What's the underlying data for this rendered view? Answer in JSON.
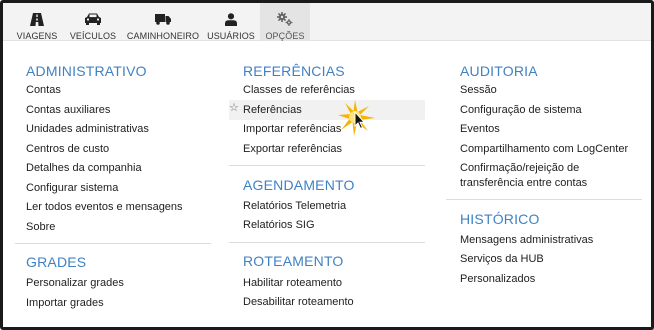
{
  "tabs": [
    {
      "label": "VIAGENS",
      "icon": "road-icon"
    },
    {
      "label": "VEÍCULOS",
      "icon": "car-icon"
    },
    {
      "label": "CAMINHONEIRO",
      "icon": "truck-icon"
    },
    {
      "label": "USUÁRIOS",
      "icon": "user-icon"
    },
    {
      "label": "OPÇÕES",
      "icon": "gears-icon",
      "active": true
    }
  ],
  "administrativo": {
    "title": "ADMINISTRATIVO",
    "items": [
      "Contas",
      "Contas auxiliares",
      "Unidades administrativas",
      "Centros de custo",
      "Detalhes da companhia",
      "Configurar sistema",
      "Ler todos eventos e mensagens",
      "Sobre"
    ]
  },
  "grades": {
    "title": "GRADES",
    "items": [
      "Personalizar grades",
      "Importar grades"
    ]
  },
  "referencias": {
    "title": "REFERÊNCIAS",
    "items": [
      "Classes de referências",
      "Referências",
      "Importar referências",
      "Exportar referências"
    ]
  },
  "agendamento": {
    "title": "AGENDAMENTO",
    "items": [
      "Relatórios Telemetria",
      "Relatórios SIG"
    ]
  },
  "roteamento": {
    "title": "ROTEAMENTO",
    "items": [
      "Habilitar roteamento",
      "Desabilitar roteamento"
    ]
  },
  "auditoria": {
    "title": "AUDITORIA",
    "items": [
      "Sessão",
      "Configuração de sistema",
      "Eventos",
      "Compartilhamento com LogCenter",
      "Confirmação/rejeição de",
      "transferência entre contas"
    ]
  },
  "historico": {
    "title": "HISTÓRICO",
    "items": [
      "Mensagens administrativas",
      "Serviços da HUB",
      "Personalizados"
    ]
  },
  "colors": {
    "accent": "#3f82c4",
    "cursor_glow": "#f5b400"
  }
}
